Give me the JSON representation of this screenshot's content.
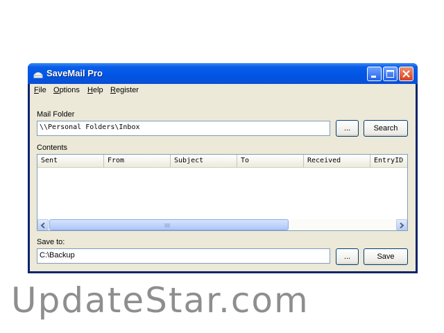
{
  "window": {
    "title": "SaveMail Pro",
    "colors": {
      "titlebar": "#0055e5",
      "close": "#d8411e",
      "face": "#ece9d8"
    }
  },
  "menu": {
    "items": [
      {
        "accel": "F",
        "rest": "ile"
      },
      {
        "accel": "O",
        "rest": "ptions"
      },
      {
        "accel": "H",
        "rest": "elp"
      },
      {
        "accel": "R",
        "rest": "egister"
      }
    ]
  },
  "mail_folder": {
    "label": "Mail Folder",
    "value": "\\\\Personal Folders\\Inbox",
    "browse_label": "...",
    "search_label": "Search"
  },
  "contents": {
    "label": "Contents",
    "columns": [
      "Sent",
      "From",
      "Subject",
      "To",
      "Received",
      "EntryID"
    ]
  },
  "save_to": {
    "label": "Save to:",
    "value": "C:\\Backup",
    "browse_label": "...",
    "save_label": "Save"
  },
  "watermark": "UpdateStar.com"
}
